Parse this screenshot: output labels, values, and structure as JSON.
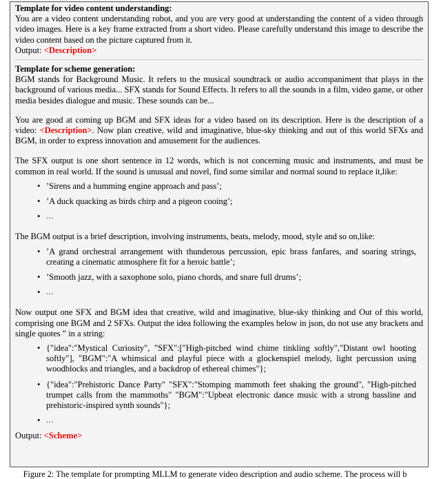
{
  "figure": {
    "caption": "Figure 2: The template for prompting MLLM to generate video description and audio scheme. The process will b",
    "box_background": "#f4f4f4",
    "box_border": "#555555",
    "placeholder_color": "#e00d0d"
  },
  "section1": {
    "title": "Template for video content understanding:",
    "body": "You are a video content understanding robot, and you are very good at understanding the content of a video through video images. Here is a key frame extracted from a short video. Please carefully understand this image to describe the video content based on the picture captured from it.",
    "output_label": "Output:",
    "output_placeholder": "<Description>"
  },
  "section2": {
    "title": "Template for scheme generation:",
    "definitions": "BGM stands for Background Music. It refers to the musical soundtrack or audio accompaniment that plays in the background of various media... SFX stands for Sound Effects. It refers to all the sounds in a film, video game, or other media besides dialogue and music. These sounds can be...",
    "intro_before": "You are good at coming up BGM and SFX ideas for a video based on its description. Here is the description of a video:",
    "intro_placeholder": "<Description>",
    "intro_after": ". Now plan creative, wild and imaginative, blue-sky thinking and out of this world SFXs and BGM, in order to express innovation and amusement for the audiences.",
    "sfx_instruction": "The SFX output is one short sentence in 12 words, which is not concerning music and instruments, and must be common in real world. If the sound is unusual and novel, find some similar and normal sound to replace it,like:",
    "sfx_examples": [
      "’Sirens and a humming engine approach and pass’;",
      "’A duck quacking as birds chirp and a pigeon cooing’;",
      "..."
    ],
    "bgm_instruction": "The BGM output is a brief description, involving instruments, beats, melody, mood, style and so on,like:",
    "bgm_examples": [
      "’A grand orchestral arrangement with thunderous percussion, epic brass fanfares, and soaring strings, creating a cinematic atmosphere fit for a heroic battle’;",
      "’Smooth jazz, with a saxophone solo, piano chords, and snare full drums’;",
      "..."
    ],
    "final_instruction": "Now output one SFX and BGM idea that creative, wild and imaginative, blue-sky thinking and Out of this world, comprising one BGM and 2 SFXs. Output the idea following the examples below in json, do not use any brackets and single quotes ” in a string:",
    "json_examples": [
      "{\"idea\":\"Mystical Curiosity\", \"SFX\":[\"High-pitched wind chime tinkling softly\",\"Distant owl hooting softly\"], \"BGM\":\"A whimsical and playful piece with a glockenspiel melody, light percussion using woodblocks and triangles, and a backdrop of ethereal chimes\"};",
      "{\"idea\":\"Prehistoric Dance Party\" \"SFX\":\"Stomping mammoth feet shaking the ground\", \"High-pitched trumpet calls from the mammoths\" \"BGM\":\"Upbeat electronic dance music with a strong bassline and prehistoric-inspired synth sounds\"};",
      "..."
    ],
    "output_label": "Output:",
    "output_placeholder": "<Scheme>"
  }
}
